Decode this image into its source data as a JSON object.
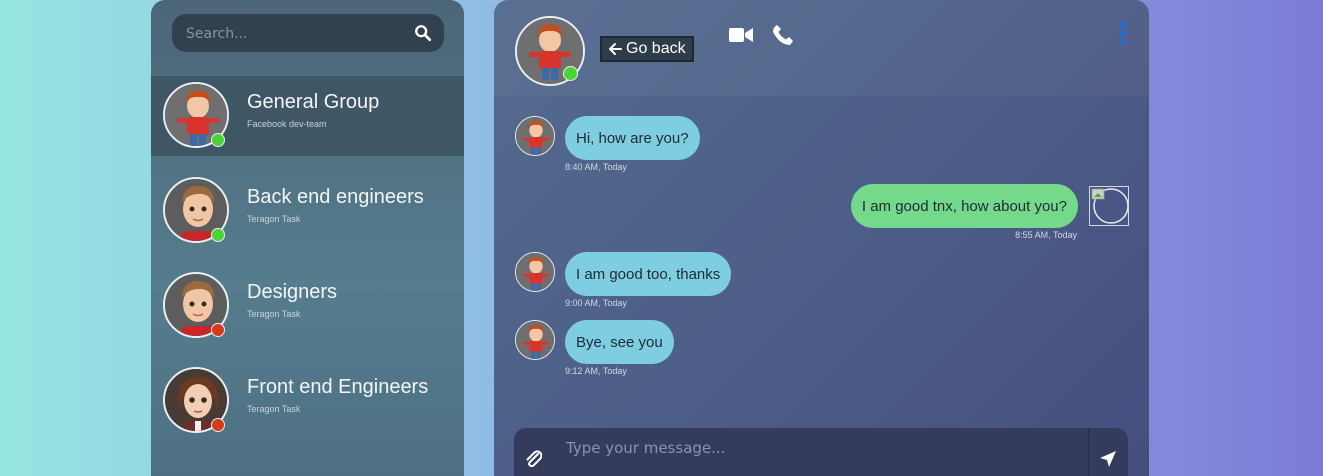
{
  "search": {
    "placeholder": "Search..."
  },
  "contacts": [
    {
      "name": "General Group",
      "subtitle": "Facebook dev-team",
      "status": "online",
      "active": true
    },
    {
      "name": "Back end engineers",
      "subtitle": "Teragon Task",
      "status": "online",
      "active": false
    },
    {
      "name": "Designers",
      "subtitle": "Teragon Task",
      "status": "offline",
      "active": false
    },
    {
      "name": "Front end Engineers",
      "subtitle": "Teragon Task",
      "status": "offline",
      "active": false
    }
  ],
  "header": {
    "go_back_label": "Go back",
    "status": "online"
  },
  "messages": [
    {
      "direction": "in",
      "text": "Hi, how are you?",
      "time": "8:40 AM, Today"
    },
    {
      "direction": "out",
      "text": "I am good tnx, how about you?",
      "time": "8:55 AM, Today"
    },
    {
      "direction": "in",
      "text": "I am good too, thanks",
      "time": "9:00 AM, Today"
    },
    {
      "direction": "in",
      "text": "Bye, see you",
      "time": "9:12 AM, Today"
    }
  ],
  "composer": {
    "placeholder": "Type your message..."
  },
  "colors": {
    "online": "#4cd137",
    "offline": "#d63a1a",
    "bubble_in": "#7fcde0",
    "bubble_out": "#75d98b"
  },
  "icons": {
    "search": "search-icon",
    "video": "video-camera-icon",
    "phone": "phone-icon",
    "menu": "vertical-dots-icon",
    "attach": "paperclip-icon",
    "send": "send-arrow-icon",
    "back": "arrow-left-icon"
  }
}
